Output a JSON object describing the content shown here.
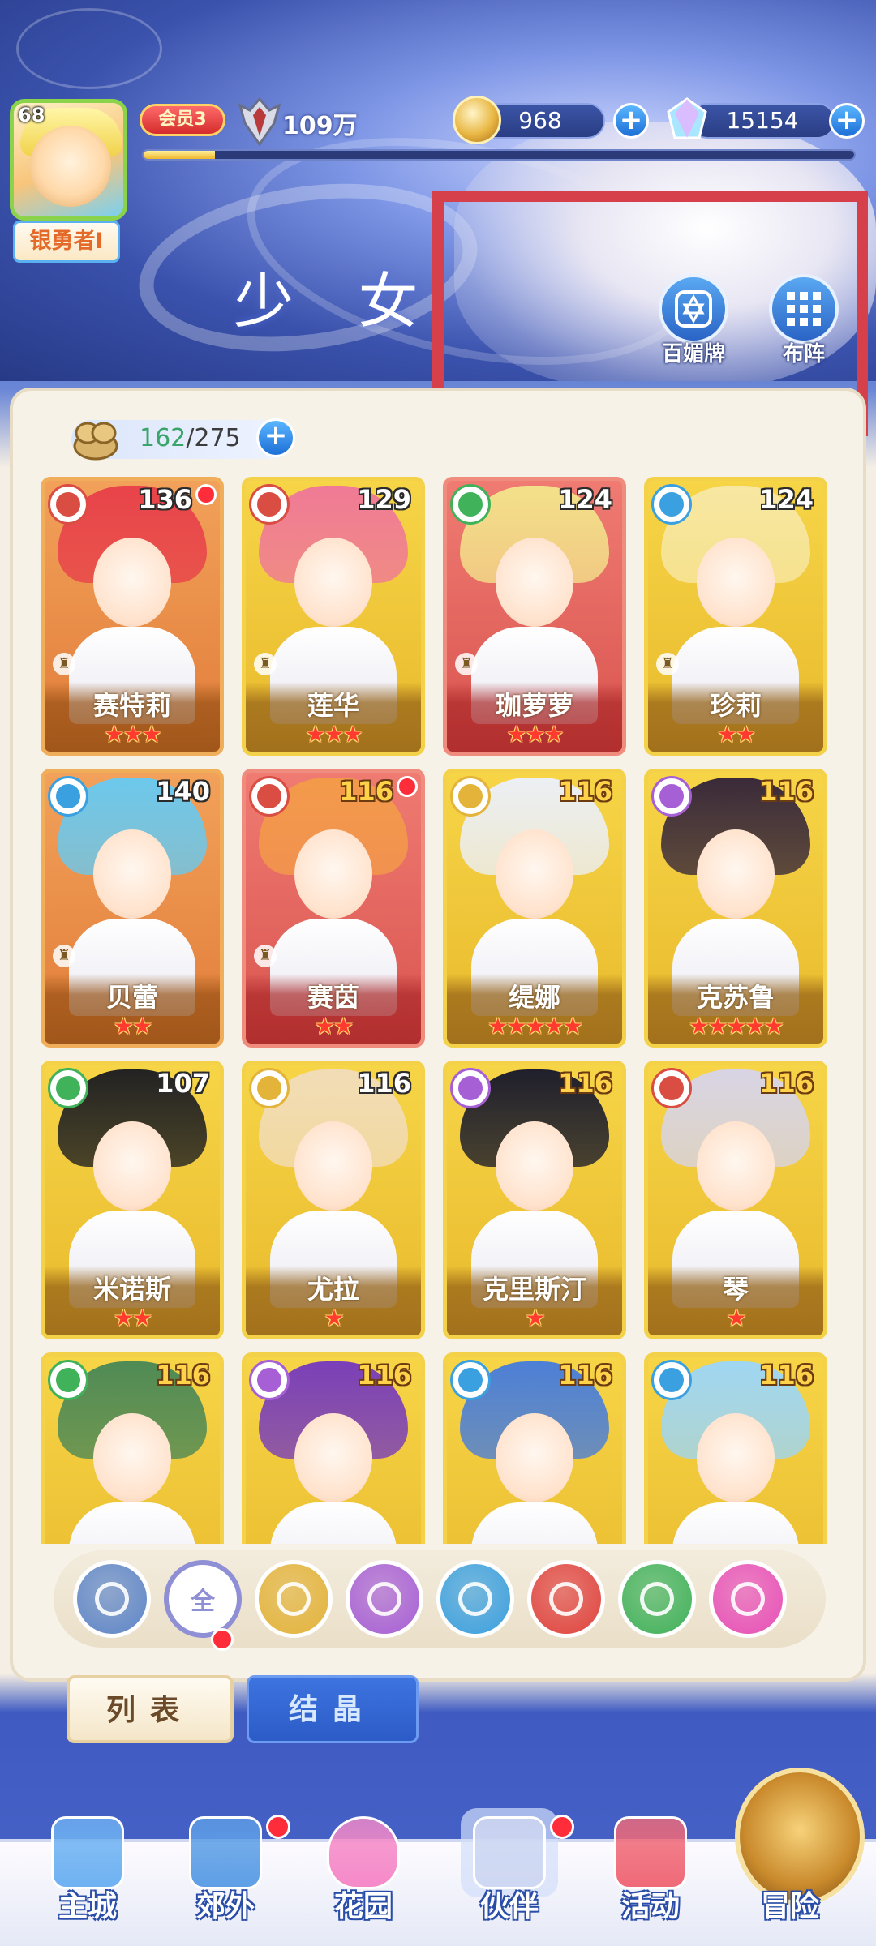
{
  "player": {
    "level": "68",
    "title": "银勇者I",
    "vip": "会员3",
    "power": "109万",
    "exp_progress": 0.1
  },
  "currencies": {
    "gold": "968",
    "gems": "15154"
  },
  "page_title": "少 女",
  "side_buttons": {
    "collection": "百媚牌",
    "formation": "布阵"
  },
  "capacity": {
    "current": "162",
    "separator": "/",
    "max": "275"
  },
  "cards": [
    {
      "name": "赛特莉",
      "level": "136",
      "stars": "★★★",
      "element": "fire",
      "frame": "orange",
      "hair": "#e8434a",
      "lvl_style": "white",
      "dot": true,
      "rook": true
    },
    {
      "name": "莲华",
      "level": "129",
      "stars": "★★★",
      "element": "fire",
      "frame": "gold",
      "hair": "#f07a96",
      "lvl_style": "white",
      "dot": false,
      "rook": true
    },
    {
      "name": "珈萝萝",
      "level": "124",
      "stars": "★★★",
      "element": "wind",
      "frame": "red",
      "hair": "#f3e08a",
      "lvl_style": "white",
      "dot": false,
      "rook": true
    },
    {
      "name": "珍莉",
      "level": "124",
      "stars": "★★",
      "element": "water",
      "frame": "gold",
      "hair": "#f7e7a2",
      "lvl_style": "white",
      "dot": false,
      "rook": true
    },
    {
      "name": "贝蕾",
      "level": "140",
      "stars": "★★",
      "element": "water",
      "frame": "orange",
      "hair": "#6cc8ec",
      "lvl_style": "white",
      "dot": false,
      "rook": true
    },
    {
      "name": "赛茵",
      "level": "116",
      "stars": "★★",
      "element": "fire",
      "frame": "red",
      "hair": "#f39a4a",
      "lvl_style": "gold",
      "dot": true,
      "rook": true
    },
    {
      "name": "缇娜",
      "level": "116",
      "stars": "★★★★★",
      "element": "light",
      "frame": "gold",
      "hair": "#eceff4",
      "lvl_style": "gold",
      "dot": false,
      "rook": false
    },
    {
      "name": "克苏鲁",
      "level": "116",
      "stars": "★★★★★",
      "element": "dark",
      "frame": "gold",
      "hair": "#3a2a3a",
      "lvl_style": "gold",
      "dot": false,
      "rook": false
    },
    {
      "name": "米诺斯",
      "level": "107",
      "stars": "★★",
      "element": "wind",
      "frame": "gold",
      "hair": "#222222",
      "lvl_style": "white",
      "dot": false,
      "rook": false
    },
    {
      "name": "尤拉",
      "level": "116",
      "stars": "★",
      "element": "light",
      "frame": "gold",
      "hair": "#f2dcb7",
      "lvl_style": "white",
      "dot": false,
      "rook": false
    },
    {
      "name": "克里斯汀",
      "level": "116",
      "stars": "★",
      "element": "dark",
      "frame": "gold",
      "hair": "#1f1f2c",
      "lvl_style": "gold",
      "dot": false,
      "rook": false
    },
    {
      "name": "琴",
      "level": "116",
      "stars": "★",
      "element": "fire",
      "frame": "gold",
      "hair": "#d8d4e4",
      "lvl_style": "gold",
      "dot": false,
      "rook": false
    },
    {
      "name": "",
      "level": "116",
      "stars": "",
      "element": "wind",
      "frame": "gold",
      "hair": "#4f8a55",
      "lvl_style": "gold",
      "dot": false,
      "rook": false
    },
    {
      "name": "",
      "level": "116",
      "stars": "",
      "element": "dark",
      "frame": "gold",
      "hair": "#7a3fb8",
      "lvl_style": "gold",
      "dot": false,
      "rook": false
    },
    {
      "name": "",
      "level": "116",
      "stars": "",
      "element": "water",
      "frame": "gold",
      "hair": "#4c7fd6",
      "lvl_style": "gold",
      "dot": false,
      "rook": false
    },
    {
      "name": "",
      "level": "116",
      "stars": "",
      "element": "water",
      "frame": "gold",
      "hair": "#9fd6f2",
      "lvl_style": "gold",
      "dot": false,
      "rook": false
    }
  ],
  "element_filters": [
    {
      "id": "sort",
      "label": "",
      "color": "#5e86c9"
    },
    {
      "id": "all",
      "label": "全",
      "color": "#8f8fd6"
    },
    {
      "id": "light",
      "label": "",
      "color": "#e3b33a"
    },
    {
      "id": "dark",
      "label": "",
      "color": "#a75fd6"
    },
    {
      "id": "water",
      "label": "",
      "color": "#3aa0e0"
    },
    {
      "id": "fire",
      "label": "",
      "color": "#e0433f"
    },
    {
      "id": "wind",
      "label": "",
      "color": "#3fb25a"
    },
    {
      "id": "charm",
      "label": "",
      "color": "#e84fb8"
    }
  ],
  "tabs": {
    "list": "列表",
    "crystal": "结晶"
  },
  "nav": [
    {
      "id": "main-city",
      "label": "主城",
      "color": "#6fb2f2",
      "dot": false
    },
    {
      "id": "outskirts",
      "label": "郊外",
      "color": "#5e9fe6",
      "dot": true
    },
    {
      "id": "garden",
      "label": "花园",
      "color": "#f58ac8",
      "dot": false
    },
    {
      "id": "partner",
      "label": "伙伴",
      "color": "#cfd8f2",
      "dot": true
    },
    {
      "id": "events",
      "label": "活动",
      "color": "#f06a78",
      "dot": false
    },
    {
      "id": "adventure",
      "label": "冒险",
      "color": "#d39a3a",
      "dot": false
    }
  ]
}
